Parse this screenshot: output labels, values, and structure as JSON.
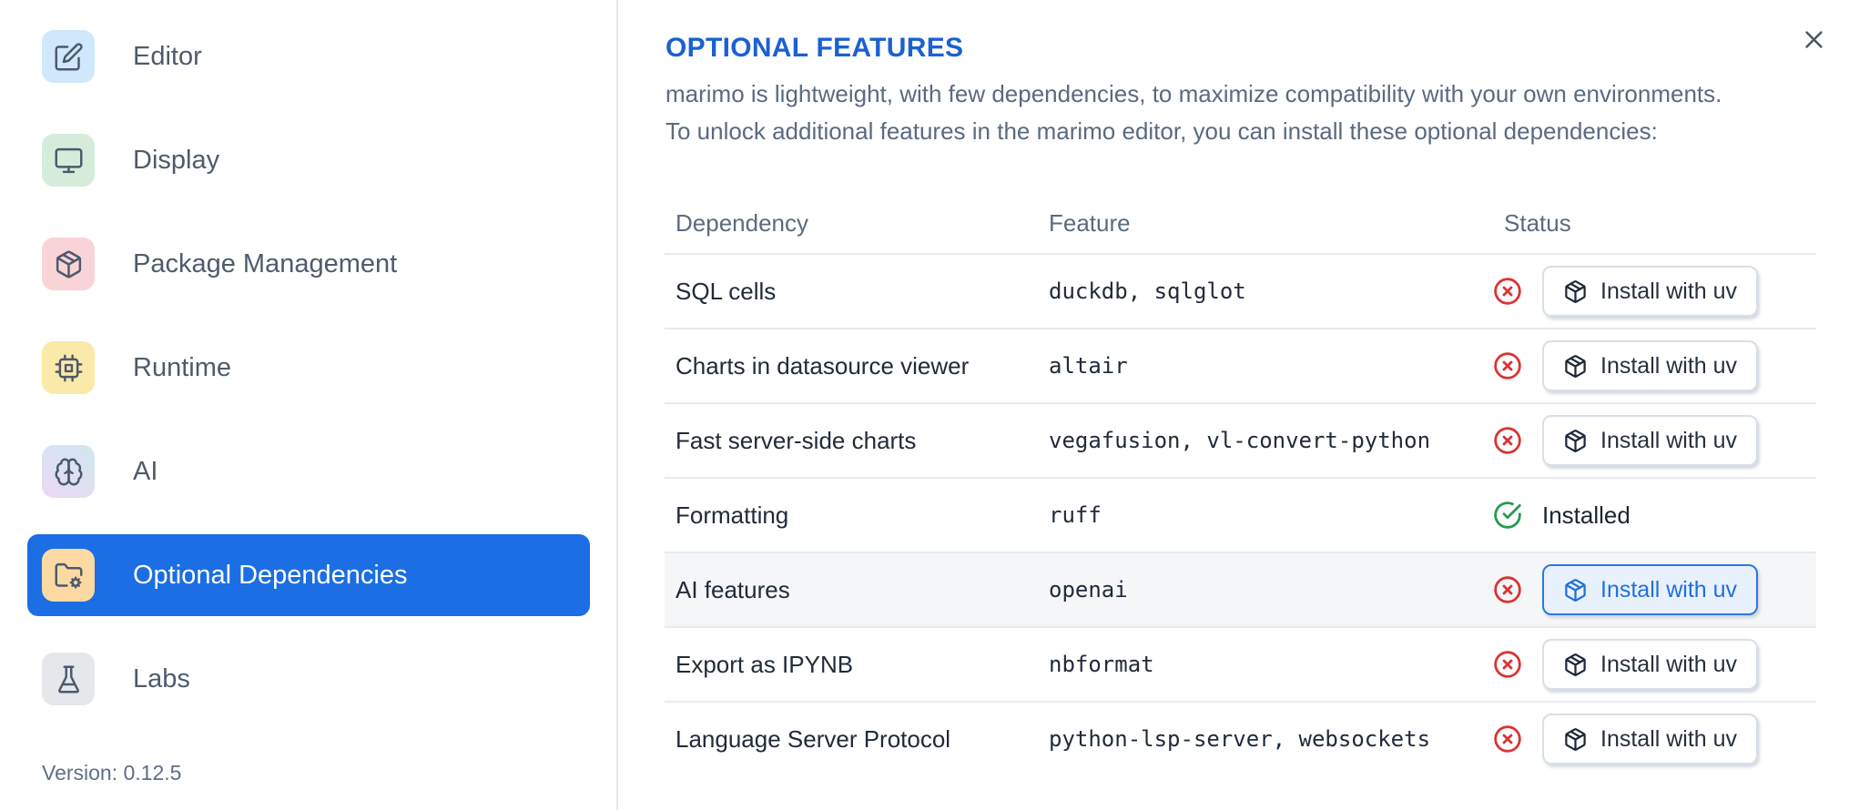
{
  "sidebar": {
    "items": [
      {
        "label": "Editor"
      },
      {
        "label": "Display"
      },
      {
        "label": "Package Management"
      },
      {
        "label": "Runtime"
      },
      {
        "label": "AI"
      },
      {
        "label": "Optional Dependencies",
        "selected": true
      },
      {
        "label": "Labs"
      }
    ],
    "version_label": "Version: 0.12.5"
  },
  "main": {
    "title": "OPTIONAL FEATURES",
    "description_line1": "marimo is lightweight, with few dependencies, to maximize compatibility with your own environments.",
    "description_line2": "To unlock additional features in the marimo editor, you can install these optional dependencies:",
    "table": {
      "columns": [
        "Dependency",
        "Feature",
        "Status"
      ],
      "rows": [
        {
          "dependency": "SQL cells",
          "feature": "duckdb, sqlglot",
          "status": "missing",
          "action": "Install with uv"
        },
        {
          "dependency": "Charts in datasource viewer",
          "feature": "altair",
          "status": "missing",
          "action": "Install with uv"
        },
        {
          "dependency": "Fast server-side charts",
          "feature": "vegafusion, vl-convert-python",
          "status": "missing",
          "action": "Install with uv"
        },
        {
          "dependency": "Formatting",
          "feature": "ruff",
          "status": "installed",
          "status_label": "Installed"
        },
        {
          "dependency": "AI features",
          "feature": "openai",
          "status": "missing",
          "action": "Install with uv",
          "highlighted": true
        },
        {
          "dependency": "Export as IPYNB",
          "feature": "nbformat",
          "status": "missing",
          "action": "Install with uv"
        },
        {
          "dependency": "Language Server Protocol",
          "feature": "python-lsp-server, websockets",
          "status": "missing",
          "action": "Install with uv"
        }
      ]
    }
  },
  "colors": {
    "accent_blue": "#1b6ee3",
    "title_blue": "#1c60d2",
    "error_red": "#d93434",
    "success_green": "#259a4f",
    "divider": "#e6eaf0"
  }
}
